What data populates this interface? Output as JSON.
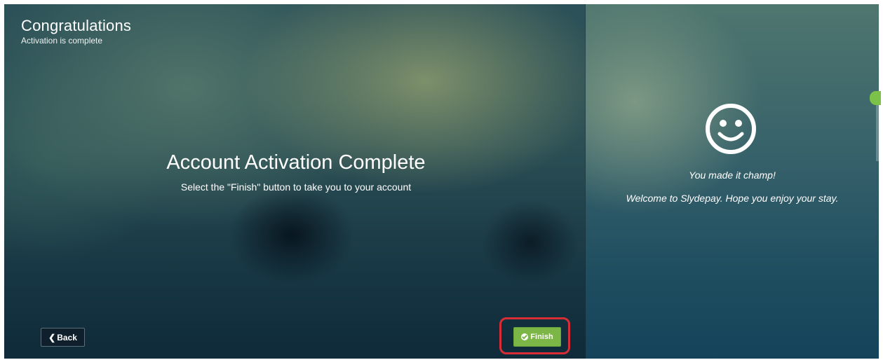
{
  "header": {
    "title": "Congratulations",
    "subtitle": "Activation is complete"
  },
  "main": {
    "heading": "Account Activation Complete",
    "instruction": "Select the \"Finish\" button to take you to your account"
  },
  "side_panel": {
    "icon": "smiley-icon",
    "line1": "You made it champ!",
    "line2": "Welcome to Slydepay. Hope you enjoy your stay."
  },
  "buttons": {
    "back_label": "Back",
    "back_icon": "chevron-left-icon",
    "finish_label": "Finish",
    "finish_icon": "check-circle-icon"
  },
  "colors": {
    "finish_green": "#7cb647",
    "highlight_red": "#d92d36",
    "back_dark": "#0f1f2c"
  }
}
